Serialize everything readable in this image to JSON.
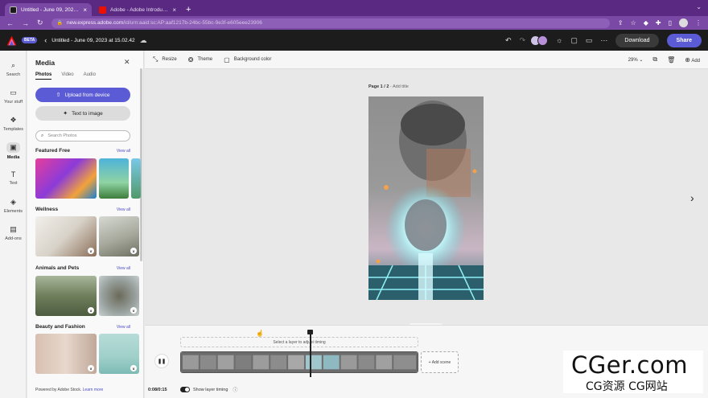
{
  "browser": {
    "tabs": [
      {
        "title": "Untitled - June 09, 2023 at 15:",
        "active": true
      },
      {
        "title": "Adobe - Adobe Introduces Cre",
        "active": false
      }
    ],
    "new_tab": "+",
    "url_domain": "new.express.adobe.com",
    "url_path": "/id/urn:aaid:sc:AP:aaf1217b-24bc-55bc-9e3f-e605eee23906"
  },
  "header": {
    "beta": "BETA",
    "doc_title": "Untitled - June 09, 2023 at 15.02.42",
    "download": "Download",
    "share": "Share"
  },
  "rail": [
    {
      "label": "Search",
      "icon": "search-icon",
      "glyph": "⌕"
    },
    {
      "label": "Your stuff",
      "icon": "folder-icon",
      "glyph": "▭"
    },
    {
      "label": "Templates",
      "icon": "templates-icon",
      "glyph": "❖"
    },
    {
      "label": "Media",
      "icon": "media-icon",
      "glyph": "▣"
    },
    {
      "label": "Text",
      "icon": "text-icon",
      "glyph": "T"
    },
    {
      "label": "Elements",
      "icon": "elements-icon",
      "glyph": "◈"
    },
    {
      "label": "Add-ons",
      "icon": "addons-icon",
      "glyph": "▤"
    }
  ],
  "panel": {
    "title": "Media",
    "tabs": [
      "Photos",
      "Video",
      "Audio"
    ],
    "upload": "Upload from device",
    "text_to_image": "Text to image",
    "search_placeholder": "Search Photos",
    "sections": [
      {
        "title": "Featured Free",
        "view_all": "View all"
      },
      {
        "title": "Wellness",
        "view_all": "View all"
      },
      {
        "title": "Animals and Pets",
        "view_all": "View all"
      },
      {
        "title": "Beauty and Fashion",
        "view_all": "View all"
      }
    ],
    "footer_text": "Powered by Adobe Stock.",
    "footer_link": "Learn more"
  },
  "toolbar": {
    "resize": "Resize",
    "theme": "Theme",
    "background": "Background color",
    "zoom": "29%",
    "add": "Add"
  },
  "canvas": {
    "page": "Page 1 / 2",
    "add_title": "- Add title"
  },
  "timeline": {
    "hint": "Select a layer to adjust timing",
    "add_scene": "+ Add scene",
    "time": "0:08/0:15",
    "show_layer_timing": "Show layer timing"
  },
  "watermark": {
    "line1": "CGer.com",
    "line2": "CG资源 CG网站"
  }
}
